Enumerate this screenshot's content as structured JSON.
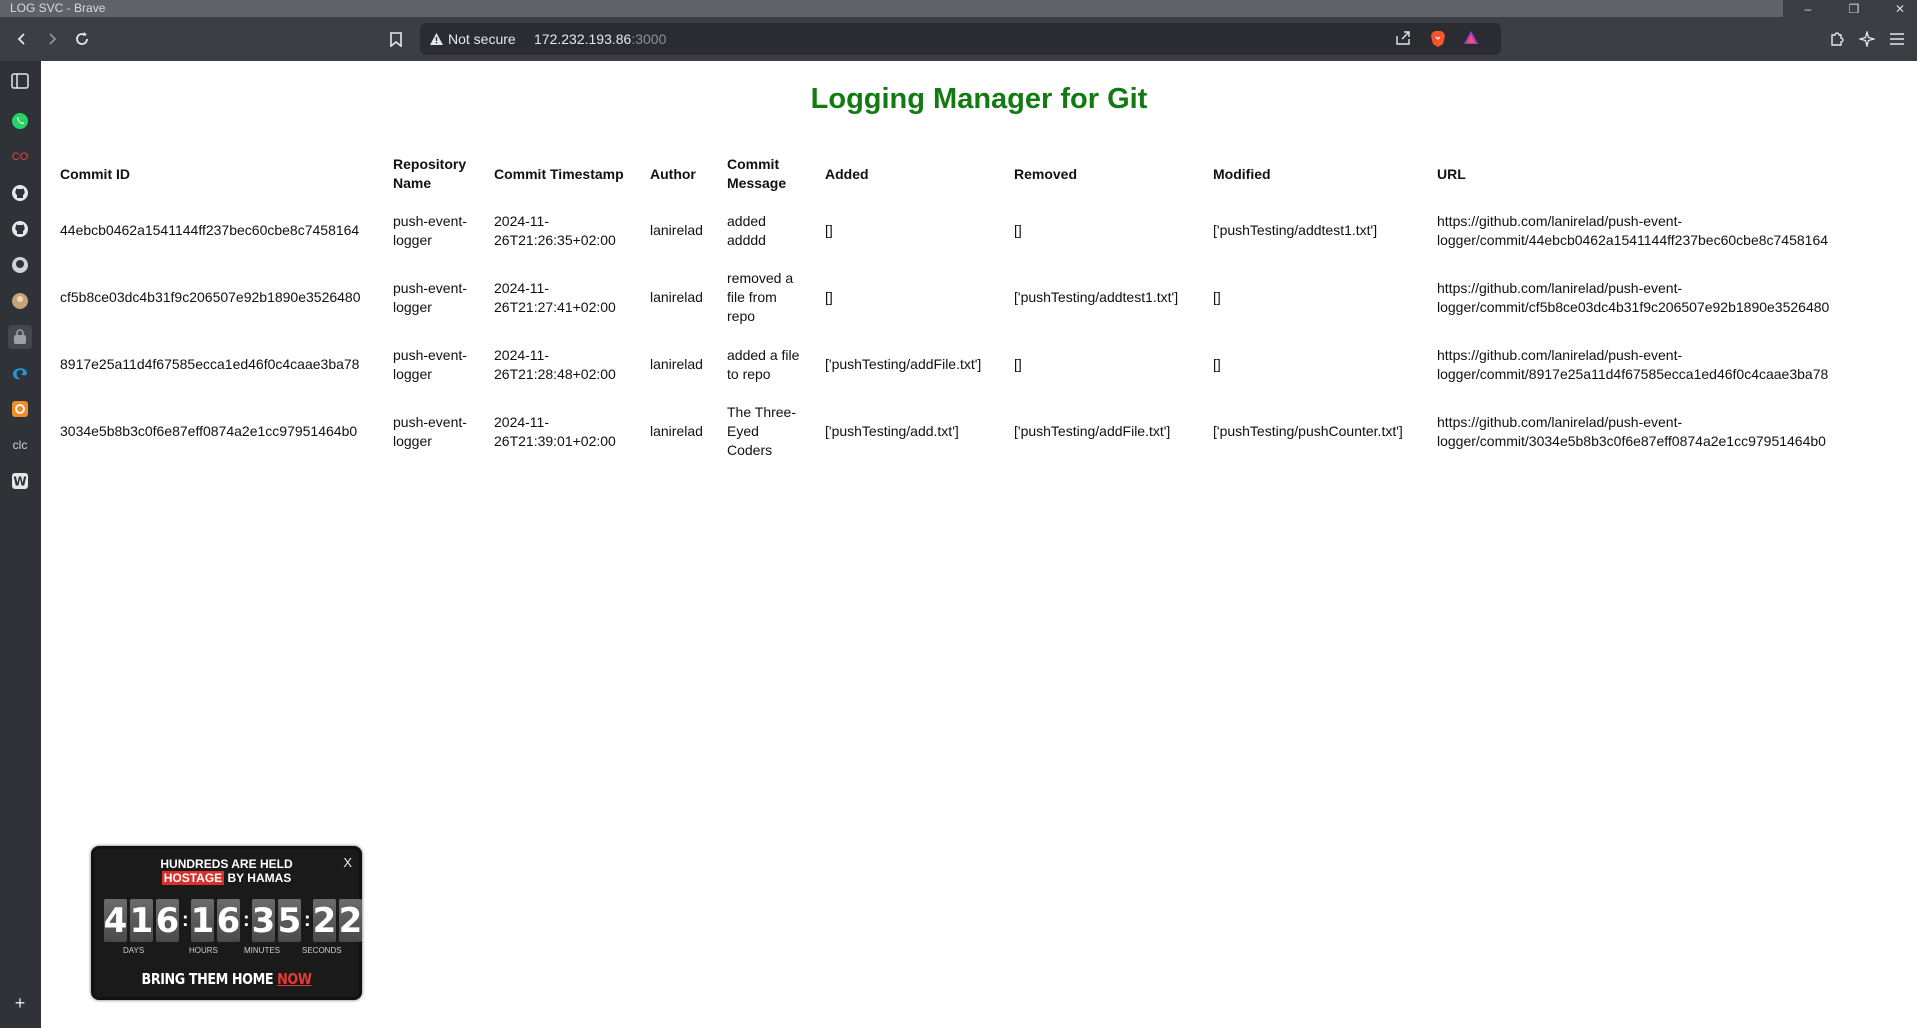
{
  "window": {
    "title": "LOG SVC - Brave",
    "min_glyph": "–",
    "max_glyph": "❐",
    "close_glyph": "✕"
  },
  "toolbar": {
    "not_secure_label": "Not secure",
    "url_host": "172.232.193.86",
    "url_port": ":3000"
  },
  "sidebar": {
    "items": [
      {
        "icon": "sidebar-toggle-icon"
      },
      {
        "icon": "whatsapp-icon"
      },
      {
        "icon": "co-icon",
        "label": "CO"
      },
      {
        "icon": "github-icon"
      },
      {
        "icon": "github-icon"
      },
      {
        "icon": "github-alt-icon"
      },
      {
        "icon": "avatar-icon"
      },
      {
        "icon": "lock-app-icon"
      },
      {
        "icon": "edge-icon"
      },
      {
        "icon": "grafana-icon"
      },
      {
        "icon": "clc-icon",
        "label": "clc"
      },
      {
        "icon": "wordpress-icon"
      }
    ],
    "add_glyph": "+"
  },
  "page": {
    "heading": "Logging Manager for Git",
    "columns": [
      "Commit ID",
      "Repository Name",
      "Commit Timestamp",
      "Author",
      "Commit Message",
      "Added",
      "Removed",
      "Modified",
      "URL"
    ],
    "rows": [
      {
        "commit_id": "44ebcb0462a1541144ff237bec60cbe8c7458164",
        "repo": "push-event-logger",
        "timestamp": "2024-11-26T21:26:35+02:00",
        "author": "lanirelad",
        "message": "added adddd",
        "added": "[]",
        "removed": "[]",
        "modified": "['pushTesting/addtest1.txt']",
        "url": "https://github.com/lanirelad/push-event-logger/commit/44ebcb0462a1541144ff237bec60cbe8c7458164"
      },
      {
        "commit_id": "cf5b8ce03dc4b31f9c206507e92b1890e3526480",
        "repo": "push-event-logger",
        "timestamp": "2024-11-26T21:27:41+02:00",
        "author": "lanirelad",
        "message": "removed a file from repo",
        "added": "[]",
        "removed": "['pushTesting/addtest1.txt']",
        "modified": "[]",
        "url": "https://github.com/lanirelad/push-event-logger/commit/cf5b8ce03dc4b31f9c206507e92b1890e3526480"
      },
      {
        "commit_id": "8917e25a11d4f67585ecca1ed46f0c4caae3ba78",
        "repo": "push-event-logger",
        "timestamp": "2024-11-26T21:28:48+02:00",
        "author": "lanirelad",
        "message": "added a file to repo",
        "added": "['pushTesting/addFile.txt']",
        "removed": "[]",
        "modified": "[]",
        "url": "https://github.com/lanirelad/push-event-logger/commit/8917e25a11d4f67585ecca1ed46f0c4caae3ba78"
      },
      {
        "commit_id": "3034e5b8b3c0f6e87eff0874a2e1cc97951464b0",
        "repo": "push-event-logger",
        "timestamp": "2024-11-26T21:39:01+02:00",
        "author": "lanirelad",
        "message": "The Three-Eyed Coders",
        "added": "['pushTesting/add.txt']",
        "removed": "['pushTesting/addFile.txt']",
        "modified": "['pushTesting/pushCounter.txt']",
        "url": "https://github.com/lanirelad/push-event-logger/commit/3034e5b8b3c0f6e87eff0874a2e1cc97951464b0"
      }
    ]
  },
  "widget": {
    "line1": "HUNDREDS ARE HELD",
    "hostage_word": "HOSTAGE",
    "line2_rest": " BY HAMAS",
    "close_label": "X",
    "days": [
      "4",
      "1",
      "6"
    ],
    "hours": [
      "1",
      "6"
    ],
    "minutes": [
      "3",
      "5"
    ],
    "seconds": [
      "2",
      "2"
    ],
    "units": {
      "days": "DAYS",
      "hours": "HOURS",
      "minutes": "MINUTES",
      "seconds": "SECONDS"
    },
    "cta_main": "BRING THEM HOME ",
    "cta_now": "NOW",
    "accent_color": "#d9302b"
  },
  "colors": {
    "heading": "#137a13",
    "toolbar": "#3b3e44",
    "sidebar": "#2f3237"
  }
}
